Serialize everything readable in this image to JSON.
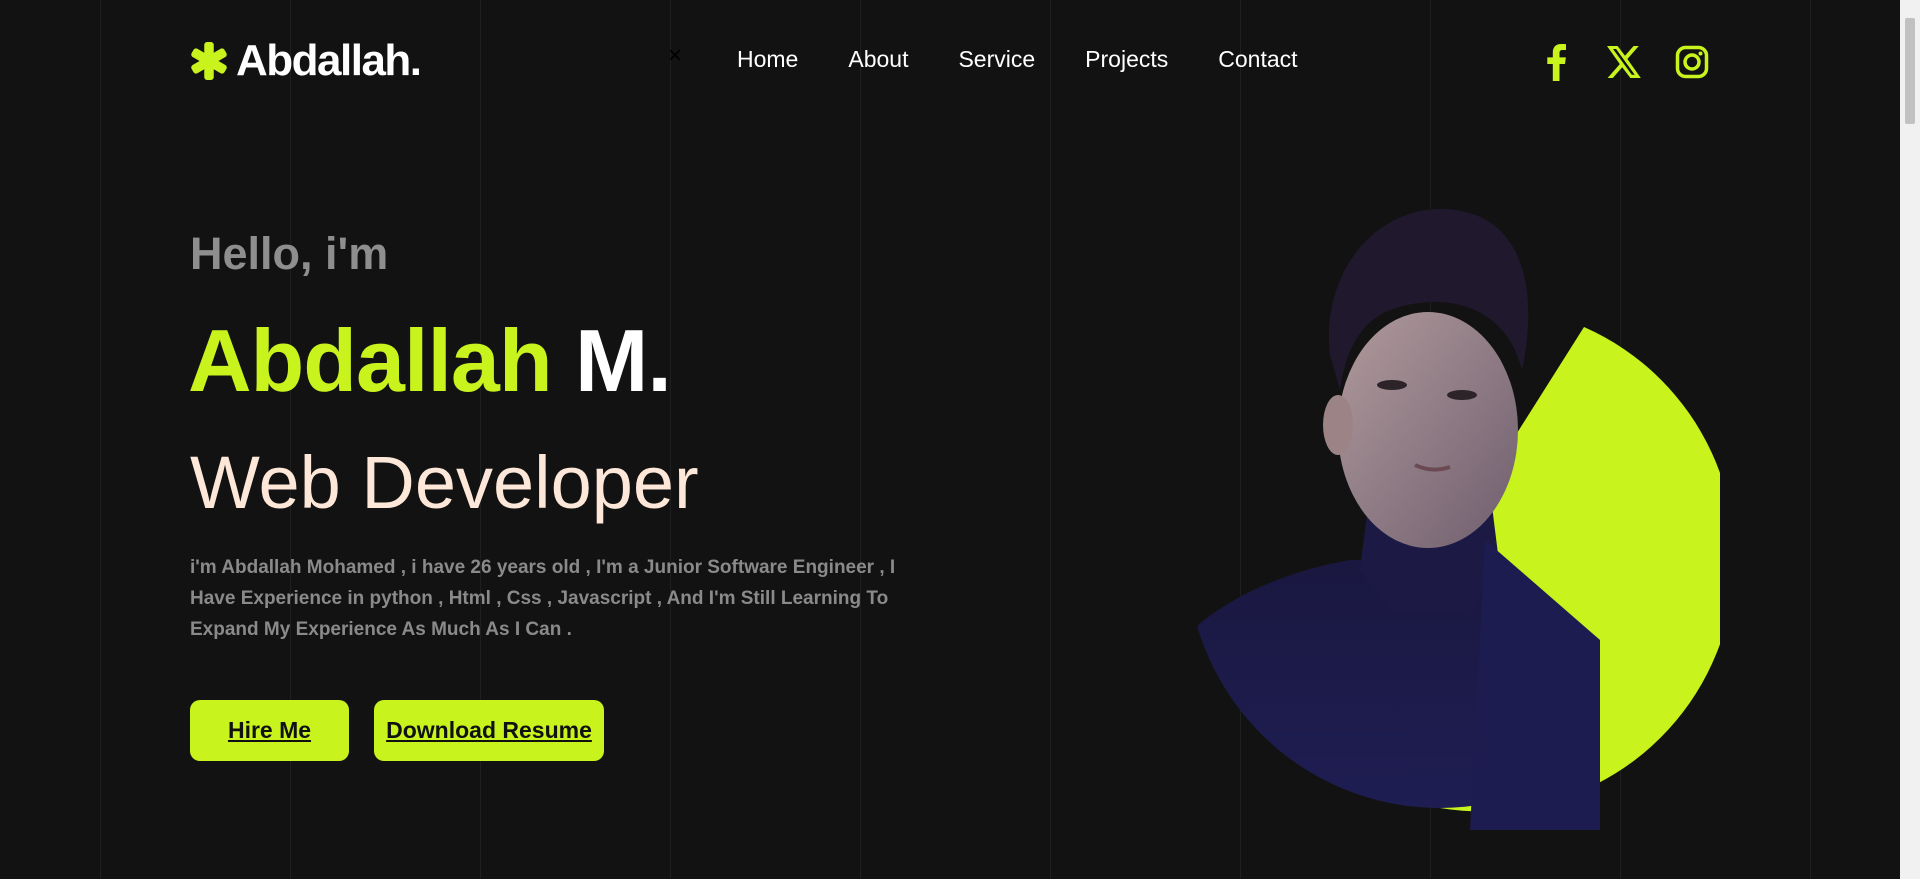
{
  "colors": {
    "accent": "#c8f31d",
    "background": "#121212",
    "role_text": "#fde7d8"
  },
  "header": {
    "logo_text": "Abdallah.",
    "logo_icon": "asterisk-icon",
    "close_glyph": "×",
    "nav": [
      {
        "label": "Home"
      },
      {
        "label": "About"
      },
      {
        "label": "Service"
      },
      {
        "label": "Projects"
      },
      {
        "label": "Contact"
      }
    ],
    "socials": [
      {
        "icon": "facebook-icon"
      },
      {
        "icon": "x-twitter-icon"
      },
      {
        "icon": "instagram-icon"
      }
    ]
  },
  "hero": {
    "greeting": "Hello, i'm",
    "first_name": "Abdallah",
    "last_name": "M.",
    "role": "Web Developer",
    "bio_lines": [
      "i'm Abdallah Mohamed , i have 26 years old , I'm a Junior Software Engineer , I",
      "Have Experience in python , Html , Css , Javascript , And I'm Still Learning To",
      "Expand My Experience As Much As I Can ."
    ],
    "hire_label": "Hire Me",
    "resume_label": "Download Resume"
  }
}
